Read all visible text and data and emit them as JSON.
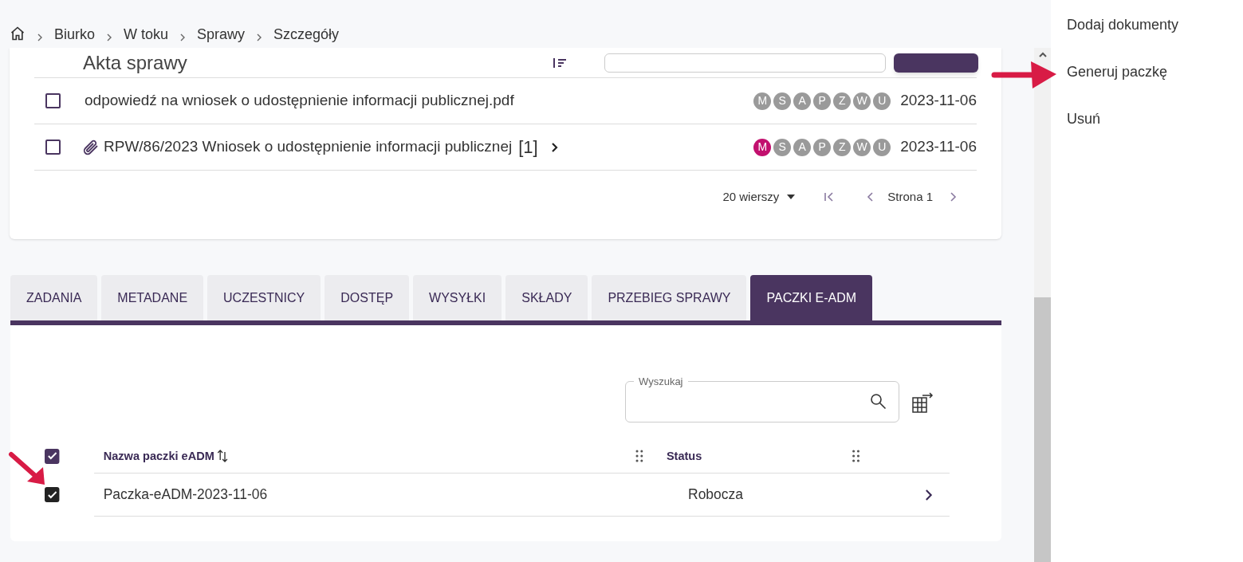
{
  "breadcrumb": [
    "Biurko",
    "W toku",
    "Sprawy",
    "Szczegóły"
  ],
  "documents": {
    "title": "Akta sprawy",
    "rows": [
      {
        "checked": false,
        "attachment": false,
        "name": "odpowiedź na wniosek o udostępnienie informacji publicznej.pdf",
        "expandable": false,
        "flags": [
          {
            "letter": "M",
            "active": false
          },
          {
            "letter": "S",
            "active": false
          },
          {
            "letter": "A",
            "active": false
          },
          {
            "letter": "P",
            "active": false
          },
          {
            "letter": "Z",
            "active": false
          },
          {
            "letter": "W",
            "active": false
          },
          {
            "letter": "U",
            "active": false
          }
        ],
        "date": "2023-11-06"
      },
      {
        "checked": false,
        "attachment": true,
        "name": "RPW/86/2023 Wniosek o udostępnienie informacji publicznej",
        "count": "[1]",
        "expandable": true,
        "flags": [
          {
            "letter": "M",
            "active": true
          },
          {
            "letter": "S",
            "active": false
          },
          {
            "letter": "A",
            "active": false
          },
          {
            "letter": "P",
            "active": false
          },
          {
            "letter": "Z",
            "active": false
          },
          {
            "letter": "W",
            "active": false
          },
          {
            "letter": "U",
            "active": false
          }
        ],
        "date": "2023-11-06"
      }
    ],
    "pagination": {
      "rows_per_page": "20 wierszy",
      "page": "Strona 1"
    }
  },
  "tabs": [
    {
      "label": "ZADANIA",
      "selected": false
    },
    {
      "label": "METADANE",
      "selected": false
    },
    {
      "label": "UCZESTNICY",
      "selected": false
    },
    {
      "label": "DOSTĘP",
      "selected": false
    },
    {
      "label": "WYSYŁKI",
      "selected": false
    },
    {
      "label": "SKŁADY",
      "selected": false
    },
    {
      "label": "PRZEBIEG SPRAWY",
      "selected": false
    },
    {
      "label": "PACZKI E-ADM",
      "selected": true
    }
  ],
  "packages": {
    "search": {
      "label": "Wyszukaj"
    },
    "select_all_checked": true,
    "columns": [
      "Nazwa paczki eADM",
      "Status"
    ],
    "rows": [
      {
        "checked": true,
        "name": "Paczka-eADM-2023-11-06",
        "status": "Robocza"
      }
    ]
  },
  "menu": [
    "Dodaj dokumenty",
    "Generuj paczkę",
    "Usuń"
  ]
}
